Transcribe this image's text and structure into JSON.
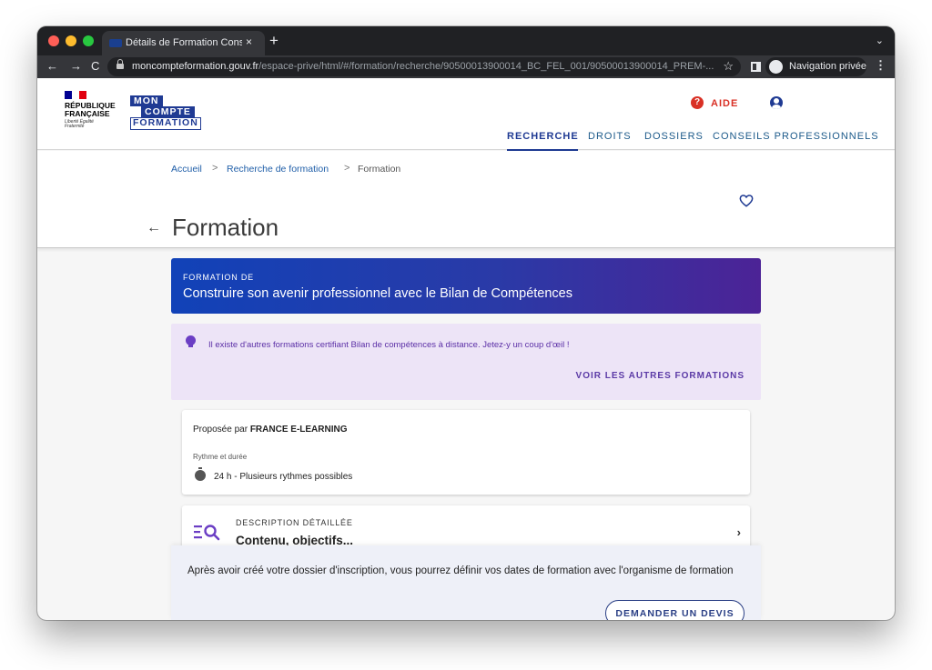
{
  "browser": {
    "tab_title": "Détails de Formation Construir",
    "tab_close": "×",
    "new_tab": "+",
    "url_domain": "moncompteformation.gouv.fr",
    "url_path": "/espace-prive/html/#/formation/recherche/90500013900014_BC_FEL_001/90500013900014_PREM-...",
    "incognito_label": "Navigation privée",
    "back": "←",
    "forward": "→",
    "reload": "C",
    "star": "☆",
    "kebab": "⋮",
    "chevron": "⌄"
  },
  "header": {
    "rf_name": "RÉPUBLIQUE FRANÇAISE",
    "rf_motto": "Liberté Égalité Fraternité",
    "logo_line1": "MON",
    "logo_line2": "COMPTE",
    "logo_line3": "FORMATION",
    "aide_label": "AIDE",
    "aide_icon": "?",
    "nav": [
      "RECHERCHE",
      "DROITS",
      "DOSSIERS",
      "CONSEILS PROFESSIONNELS"
    ]
  },
  "breadcrumb": {
    "items": [
      "Accueil",
      "Recherche de formation",
      "Formation"
    ],
    "separator": ">"
  },
  "page": {
    "back_arrow": "←",
    "title": "Formation"
  },
  "banner": {
    "kicker": "FORMATION DE",
    "title": "Construire son avenir professionnel avec le Bilan de Compétences"
  },
  "tip": {
    "text": "Il existe d'autres formations certifiant Bilan de compétences à distance. Jetez-y un coup d'œil !",
    "link": "VOIR LES AUTRES FORMATIONS"
  },
  "provider_card": {
    "prefix": "Proposée par ",
    "provider": "FRANCE E-LEARNING",
    "rhythm_label": "Rythme et durée",
    "duration": "24 h -  Plusieurs rythmes possibles"
  },
  "description_card": {
    "kicker": "DESCRIPTION DÉTAILLÉE",
    "title": "Contenu, objectifs...",
    "chevron": "›"
  },
  "footer": {
    "text": "Après avoir créé votre dossier d'inscription, vous pourrez définir vos dates de formation avec l'organisme de formation",
    "button": "DEMANDER UN DEVIS"
  },
  "colors": {
    "brand_blue": "#1f3a93",
    "aide_red": "#d93025",
    "tip_purple": "#5b2fa6",
    "banner_start": "#1142b8",
    "banner_end": "#4c2396"
  }
}
